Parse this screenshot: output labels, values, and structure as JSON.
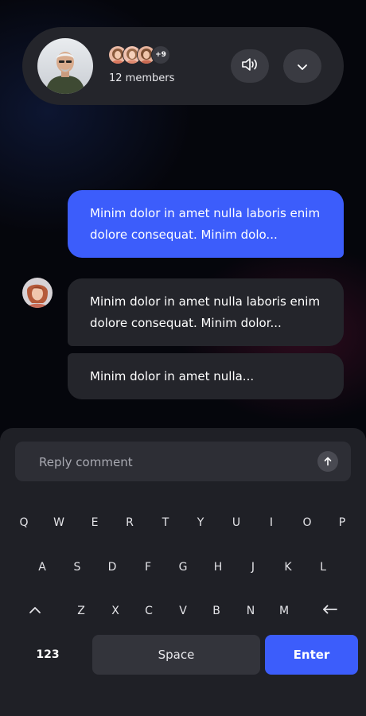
{
  "header": {
    "member_more": "+9",
    "member_count": "12 members"
  },
  "icons": {
    "speaker": "speaker-icon",
    "collapse": "chevron-down-icon",
    "send": "arrow-up-icon",
    "shift": "shift-icon",
    "backspace": "backspace-icon"
  },
  "messages": [
    {
      "from": "me",
      "text": "Minim dolor in amet nulla laboris enim dolore consequat. Minim dolo..."
    },
    {
      "from": "other",
      "text": "Minim dolor in amet nulla laboris enim dolore consequat. Minim dolor..."
    },
    {
      "from": "other",
      "text": "Minim dolor in amet nulla..."
    }
  ],
  "reply": {
    "placeholder": "Reply comment",
    "value": ""
  },
  "keyboard": {
    "row1": [
      "Q",
      "W",
      "E",
      "R",
      "T",
      "Y",
      "U",
      "I",
      "O",
      "P"
    ],
    "row2": [
      "A",
      "S",
      "D",
      "F",
      "G",
      "H",
      "J",
      "K",
      "L"
    ],
    "row3": [
      "Z",
      "X",
      "C",
      "V",
      "B",
      "N",
      "M"
    ],
    "numbers_label": "123",
    "space_label": "Space",
    "enter_label": "Enter"
  },
  "colors": {
    "accent": "#3c5dfb",
    "surface": "#24252b",
    "panel": "#1f2026",
    "background": "#05060c"
  }
}
